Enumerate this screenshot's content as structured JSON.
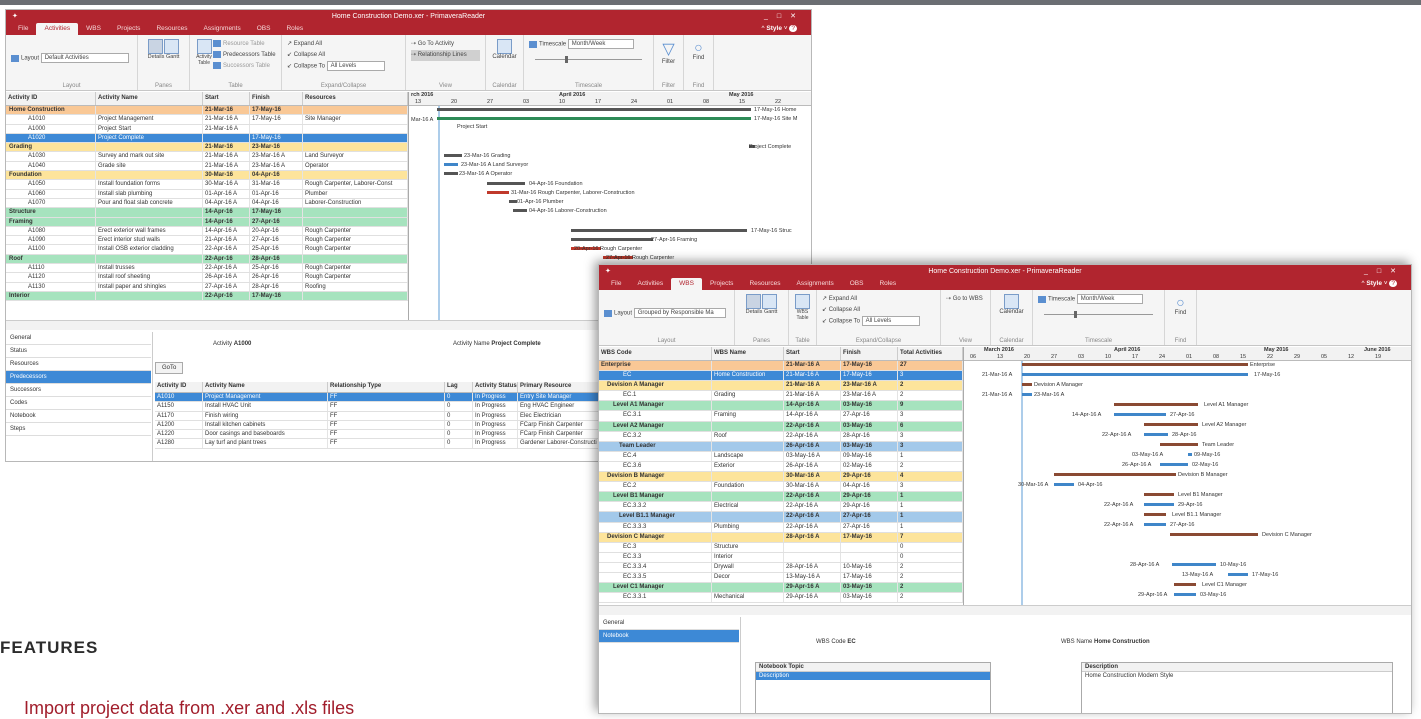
{
  "window1": {
    "title": "Home Construction Demo.xer - PrimaveraReader",
    "menu": [
      "File",
      "Activities",
      "WBS",
      "Projects",
      "Resources",
      "Assignments",
      "OBS",
      "Roles"
    ],
    "active_menu": "Activities",
    "style_label": "Style",
    "ribbon": {
      "layout_label": "Layout",
      "layout_value": "Default Activities",
      "details": "Details",
      "gantt": "Gantt",
      "activity_table": "Activity Table",
      "resource_table": "Resource Table",
      "predecessors_table": "Predecessors Table",
      "successors_table": "Successors Table",
      "expand_all": "Expand All",
      "collapse_all": "Collapse All",
      "collapse_to": "Collapse To",
      "collapse_to_value": "All Levels",
      "go_to_activity": "Go To Activity",
      "relationship_lines": "Relationship Lines",
      "calendar": "Calendar",
      "timescale": "Timescale",
      "timescale_value": "Month/Week",
      "filter": "Filter",
      "find": "Find",
      "groups": [
        "Layout",
        "Panes",
        "Table",
        "Expand/Collapse",
        "View",
        "Calendar",
        "Timescale",
        "Filter",
        "Find"
      ]
    },
    "columns": [
      "Activity ID",
      "Activity Name",
      "Start",
      "Finish",
      "Resources"
    ],
    "rows": [
      {
        "lvl": "l0",
        "id": "Home Construction",
        "name": "",
        "start": "21-Mar-16",
        "finish": "17-May-16",
        "res": ""
      },
      {
        "lvl": "",
        "id": "A1010",
        "name": "Project Management",
        "start": "21-Mar-16 A",
        "finish": "17-May-16",
        "res": "Site Manager"
      },
      {
        "lvl": "",
        "id": "A1000",
        "name": "Project Start",
        "start": "21-Mar-16 A",
        "finish": "",
        "res": ""
      },
      {
        "lvl": "sel",
        "id": "A1020",
        "name": "Project Complete",
        "start": "",
        "finish": "17-May-16",
        "res": ""
      },
      {
        "lvl": "l1",
        "id": "Grading",
        "name": "",
        "start": "21-Mar-16",
        "finish": "23-Mar-16",
        "res": ""
      },
      {
        "lvl": "",
        "id": "A1030",
        "name": "Survey and mark out site",
        "start": "21-Mar-16 A",
        "finish": "23-Mar-16 A",
        "res": "Land Surveyor"
      },
      {
        "lvl": "",
        "id": "A1040",
        "name": "Grade site",
        "start": "21-Mar-16 A",
        "finish": "23-Mar-16 A",
        "res": "Operator"
      },
      {
        "lvl": "l1",
        "id": "Foundation",
        "name": "",
        "start": "30-Mar-16",
        "finish": "04-Apr-16",
        "res": ""
      },
      {
        "lvl": "",
        "id": "A1050",
        "name": "Install foundation forms",
        "start": "30-Mar-16 A",
        "finish": "31-Mar-16",
        "res": "Rough Carpenter, Laborer-Const"
      },
      {
        "lvl": "",
        "id": "A1060",
        "name": "Install slab plumbing",
        "start": "01-Apr-16 A",
        "finish": "01-Apr-16",
        "res": "Plumber"
      },
      {
        "lvl": "",
        "id": "A1070",
        "name": "Pour and float slab concrete",
        "start": "04-Apr-16 A",
        "finish": "04-Apr-16",
        "res": "Laborer-Construction"
      },
      {
        "lvl": "l2",
        "id": "Structure",
        "name": "",
        "start": "14-Apr-16",
        "finish": "17-May-16",
        "res": ""
      },
      {
        "lvl": "l2",
        "id": "Framing",
        "name": "",
        "start": "14-Apr-16",
        "finish": "27-Apr-16",
        "res": ""
      },
      {
        "lvl": "",
        "id": "A1080",
        "name": "Erect exterior wall frames",
        "start": "14-Apr-16 A",
        "finish": "20-Apr-16",
        "res": "Rough Carpenter"
      },
      {
        "lvl": "",
        "id": "A1090",
        "name": "Erect interior stud walls",
        "start": "21-Apr-16 A",
        "finish": "27-Apr-16",
        "res": "Rough Carpenter"
      },
      {
        "lvl": "",
        "id": "A1100",
        "name": "Install OSB exterior cladding",
        "start": "22-Apr-16 A",
        "finish": "25-Apr-16",
        "res": "Rough Carpenter"
      },
      {
        "lvl": "l2",
        "id": "Roof",
        "name": "",
        "start": "22-Apr-16",
        "finish": "28-Apr-16",
        "res": ""
      },
      {
        "lvl": "",
        "id": "A1110",
        "name": "Install trusses",
        "start": "22-Apr-16 A",
        "finish": "25-Apr-16",
        "res": "Rough Carpenter"
      },
      {
        "lvl": "",
        "id": "A1120",
        "name": "Install roof sheeting",
        "start": "26-Apr-16 A",
        "finish": "26-Apr-16",
        "res": "Rough Carpenter"
      },
      {
        "lvl": "",
        "id": "A1130",
        "name": "Install paper and shingles",
        "start": "27-Apr-16 A",
        "finish": "28-Apr-16",
        "res": "Roofing"
      },
      {
        "lvl": "l2",
        "id": "Interior",
        "name": "",
        "start": "22-Apr-16",
        "finish": "17-May-16",
        "res": ""
      }
    ],
    "gantt_months": [
      "rch 2016",
      "April 2016",
      "May 2016"
    ],
    "gantt_weeks": [
      "13",
      "20",
      "27",
      "03",
      "10",
      "17",
      "24",
      "01",
      "08",
      "15",
      "22"
    ],
    "gantt_labels": [
      "17-May-16  Home",
      "17-May-16  Site M",
      "Mar-16 A",
      "Project Start",
      "Project Complete",
      "23-Mar-16  Grading",
      "23-Mar-16 A  Land Surveyor",
      "23-Mar-16 A  Operator",
      "04-Apr-16  Foundation",
      "31-Mar-16  Rough Carpenter, Laborer-Construction",
      "01-Apr-16  Plumber",
      "04-Apr-16  Laborer-Construction",
      "17-May-16  Struc",
      "27-Apr-16  Framing",
      "20-Apr-16  Rough Carpenter",
      "27-Apr-16  Rough Carpenter"
    ],
    "side_tabs": [
      "General",
      "Status",
      "Resources",
      "Predecessors",
      "Successors",
      "Codes",
      "Notebook",
      "Steps"
    ],
    "side_active": "Predecessors",
    "detail": {
      "activity_label": "Activity",
      "activity_value": "A1000",
      "activity_name_label": "Activity Name",
      "activity_name_value": "Project Complete",
      "goto": "GoTo",
      "columns": [
        "Activity ID",
        "Activity Name",
        "Relationship Type",
        "Lag",
        "Activity Status",
        "Primary Resource"
      ],
      "rows": [
        [
          "A1010",
          "Project Management",
          "FF",
          "0",
          "In Progress",
          "Entry Site Manager"
        ],
        [
          "A1150",
          "Install HVAC Unit",
          "FF",
          "0",
          "In Progress",
          "Eng HVAC Engineer"
        ],
        [
          "A1170",
          "Finish wiring",
          "FF",
          "0",
          "In Progress",
          "Elec Electrician"
        ],
        [
          "A1200",
          "Install kitchen cabinets",
          "FF",
          "0",
          "In Progress",
          "FCarp Finish Carpenter"
        ],
        [
          "A1220",
          "Door casings and baseboards",
          "FF",
          "0",
          "In Progress",
          "FCarp Finish Carpenter"
        ],
        [
          "A1280",
          "Lay turf and plant trees",
          "FF",
          "0",
          "In Progress",
          "Gardener Laborer-Constructi"
        ]
      ]
    }
  },
  "window2": {
    "title": "Home Construction Demo.xer - PrimaveraReader",
    "menu": [
      "File",
      "Activities",
      "WBS",
      "Projects",
      "Resources",
      "Assignments",
      "OBS",
      "Roles"
    ],
    "active_menu": "WBS",
    "style_label": "Style",
    "ribbon": {
      "layout_label": "Layout",
      "layout_value": "Grouped by Responsible Ma",
      "details": "Details",
      "gantt": "Gantt",
      "wbs_table": "WBS Table",
      "expand_all": "Expand All",
      "collapse_all": "Collapse All",
      "collapse_to": "Collapse To",
      "collapse_to_value": "All Levels",
      "go_to_wbs": "Go to WBS",
      "calendar": "Calendar",
      "timescale": "Timescale",
      "timescale_value": "Month/Week",
      "find": "Find",
      "groups": [
        "Layout",
        "Panes",
        "Table",
        "Expand/Collapse",
        "View",
        "Calendar",
        "Timescale",
        "Find"
      ]
    },
    "columns": [
      "WBS Code",
      "WBS Name",
      "Start",
      "Finish",
      "Total Activities"
    ],
    "rows": [
      {
        "lvl": "l0",
        "code": "Enterprise",
        "name": "",
        "start": "21-Mar-16 A",
        "finish": "17-May-16",
        "total": "27"
      },
      {
        "lvl": "sel",
        "code": "EC",
        "name": "Home Construction",
        "start": "21-Mar-16 A",
        "finish": "17-May-16",
        "total": "3"
      },
      {
        "lvl": "l1",
        "code": "Devision A Manager",
        "name": "",
        "start": "21-Mar-16 A",
        "finish": "23-Mar-16 A",
        "total": "2"
      },
      {
        "lvl": "",
        "code": "EC.1",
        "name": "Grading",
        "start": "21-Mar-16 A",
        "finish": "23-Mar-16 A",
        "total": "2"
      },
      {
        "lvl": "l2",
        "code": "Level A1 Manager",
        "name": "",
        "start": "14-Apr-16 A",
        "finish": "03-May-16",
        "total": "9"
      },
      {
        "lvl": "",
        "code": "EC.3.1",
        "name": "Framing",
        "start": "14-Apr-16 A",
        "finish": "27-Apr-16",
        "total": "3"
      },
      {
        "lvl": "l2",
        "code": "Level A2 Manager",
        "name": "",
        "start": "22-Apr-16 A",
        "finish": "03-May-16",
        "total": "6"
      },
      {
        "lvl": "",
        "code": "EC.3.2",
        "name": "Roof",
        "start": "22-Apr-16 A",
        "finish": "28-Apr-16",
        "total": "3"
      },
      {
        "lvl": "l3",
        "code": "Team Leader",
        "name": "",
        "start": "26-Apr-16 A",
        "finish": "03-May-16",
        "total": "3"
      },
      {
        "lvl": "",
        "code": "EC.4",
        "name": "Landscape",
        "start": "03-May-16 A",
        "finish": "09-May-16",
        "total": "1"
      },
      {
        "lvl": "",
        "code": "EC.3.6",
        "name": "Exterior",
        "start": "26-Apr-16 A",
        "finish": "02-May-16",
        "total": "2"
      },
      {
        "lvl": "l1",
        "code": "Devision B Manager",
        "name": "",
        "start": "30-Mar-16 A",
        "finish": "29-Apr-16",
        "total": "4"
      },
      {
        "lvl": "",
        "code": "EC.2",
        "name": "Foundation",
        "start": "30-Mar-16 A",
        "finish": "04-Apr-16",
        "total": "3"
      },
      {
        "lvl": "l2",
        "code": "Level B1 Manager",
        "name": "",
        "start": "22-Apr-16 A",
        "finish": "29-Apr-16",
        "total": "1"
      },
      {
        "lvl": "",
        "code": "EC.3.3.2",
        "name": "Electrical",
        "start": "22-Apr-16 A",
        "finish": "29-Apr-16",
        "total": "1"
      },
      {
        "lvl": "l3",
        "code": "Level B1.1 Manager",
        "name": "",
        "start": "22-Apr-16 A",
        "finish": "27-Apr-16",
        "total": "1"
      },
      {
        "lvl": "",
        "code": "EC.3.3.3",
        "name": "Plumbing",
        "start": "22-Apr-16 A",
        "finish": "27-Apr-16",
        "total": "1"
      },
      {
        "lvl": "l1",
        "code": "Devision C Manager",
        "name": "",
        "start": "28-Apr-16 A",
        "finish": "17-May-16",
        "total": "7"
      },
      {
        "lvl": "",
        "code": "EC.3",
        "name": "Structure",
        "start": "",
        "finish": "",
        "total": "0"
      },
      {
        "lvl": "",
        "code": "EC.3.3",
        "name": "Interior",
        "start": "",
        "finish": "",
        "total": "0"
      },
      {
        "lvl": "",
        "code": "EC.3.3.4",
        "name": "Drywall",
        "start": "28-Apr-16 A",
        "finish": "10-May-16",
        "total": "2"
      },
      {
        "lvl": "",
        "code": "EC.3.3.5",
        "name": "Decor",
        "start": "13-May-16 A",
        "finish": "17-May-16",
        "total": "2"
      },
      {
        "lvl": "l2",
        "code": "Level C1 Manager",
        "name": "",
        "start": "29-Apr-16 A",
        "finish": "03-May-16",
        "total": "2"
      },
      {
        "lvl": "",
        "code": "EC.3.3.1",
        "name": "Mechanical",
        "start": "29-Apr-16 A",
        "finish": "03-May-16",
        "total": "2"
      }
    ],
    "gantt_months": [
      "March 2016",
      "April 2016",
      "May 2016",
      "June 2016"
    ],
    "gantt_weeks": [
      "06",
      "13",
      "20",
      "27",
      "03",
      "10",
      "17",
      "24",
      "01",
      "08",
      "15",
      "22",
      "29",
      "05",
      "12",
      "19"
    ],
    "gantt_labels": [
      "Enterprise",
      "17-May-16",
      "21-Mar-16 A",
      "Devision A Manager",
      "21-Mar-16 A",
      "23-Mar-16 A",
      "Level A1 Manager",
      "14-Apr-16 A",
      "27-Apr-16",
      "Level A2 Manager",
      "22-Apr-16 A",
      "28-Apr-16",
      "Team Leader",
      "03-May-16 A",
      "09-May-16",
      "26-Apr-16 A",
      "02-May-16",
      "Devision B Manager",
      "30-Mar-16 A",
      "04-Apr-16",
      "Level B1 Manager",
      "22-Apr-16 A",
      "29-Apr-16",
      "Level B1.1 Manager",
      "22-Apr-16 A",
      "27-Apr-16",
      "Devision C Manager",
      "28-Apr-16 A",
      "10-May-16",
      "13-May-16 A",
      "17-May-16",
      "Level C1 Manager",
      "29-Apr-16 A",
      "03-May-16"
    ],
    "side_tabs": [
      "General",
      "Notebook"
    ],
    "side_active": "Notebook",
    "detail": {
      "wbs_code_label": "WBS Code",
      "wbs_code_value": "EC",
      "wbs_name_label": "WBS Name",
      "wbs_name_value": "Home Construction",
      "notebook_topic": "Notebook Topic",
      "notebook_topic_value": "Description",
      "description": "Description",
      "description_value": "Home Construction Modern Style"
    }
  },
  "features_heading": "FEATURES",
  "feature_bullet": "Import project data from .xer and .xls files",
  "colors": {
    "accent": "#b1252f",
    "selection": "#3d89d6",
    "wbs_bar": "#8a4a33",
    "act_bar": "#3f86c9"
  }
}
